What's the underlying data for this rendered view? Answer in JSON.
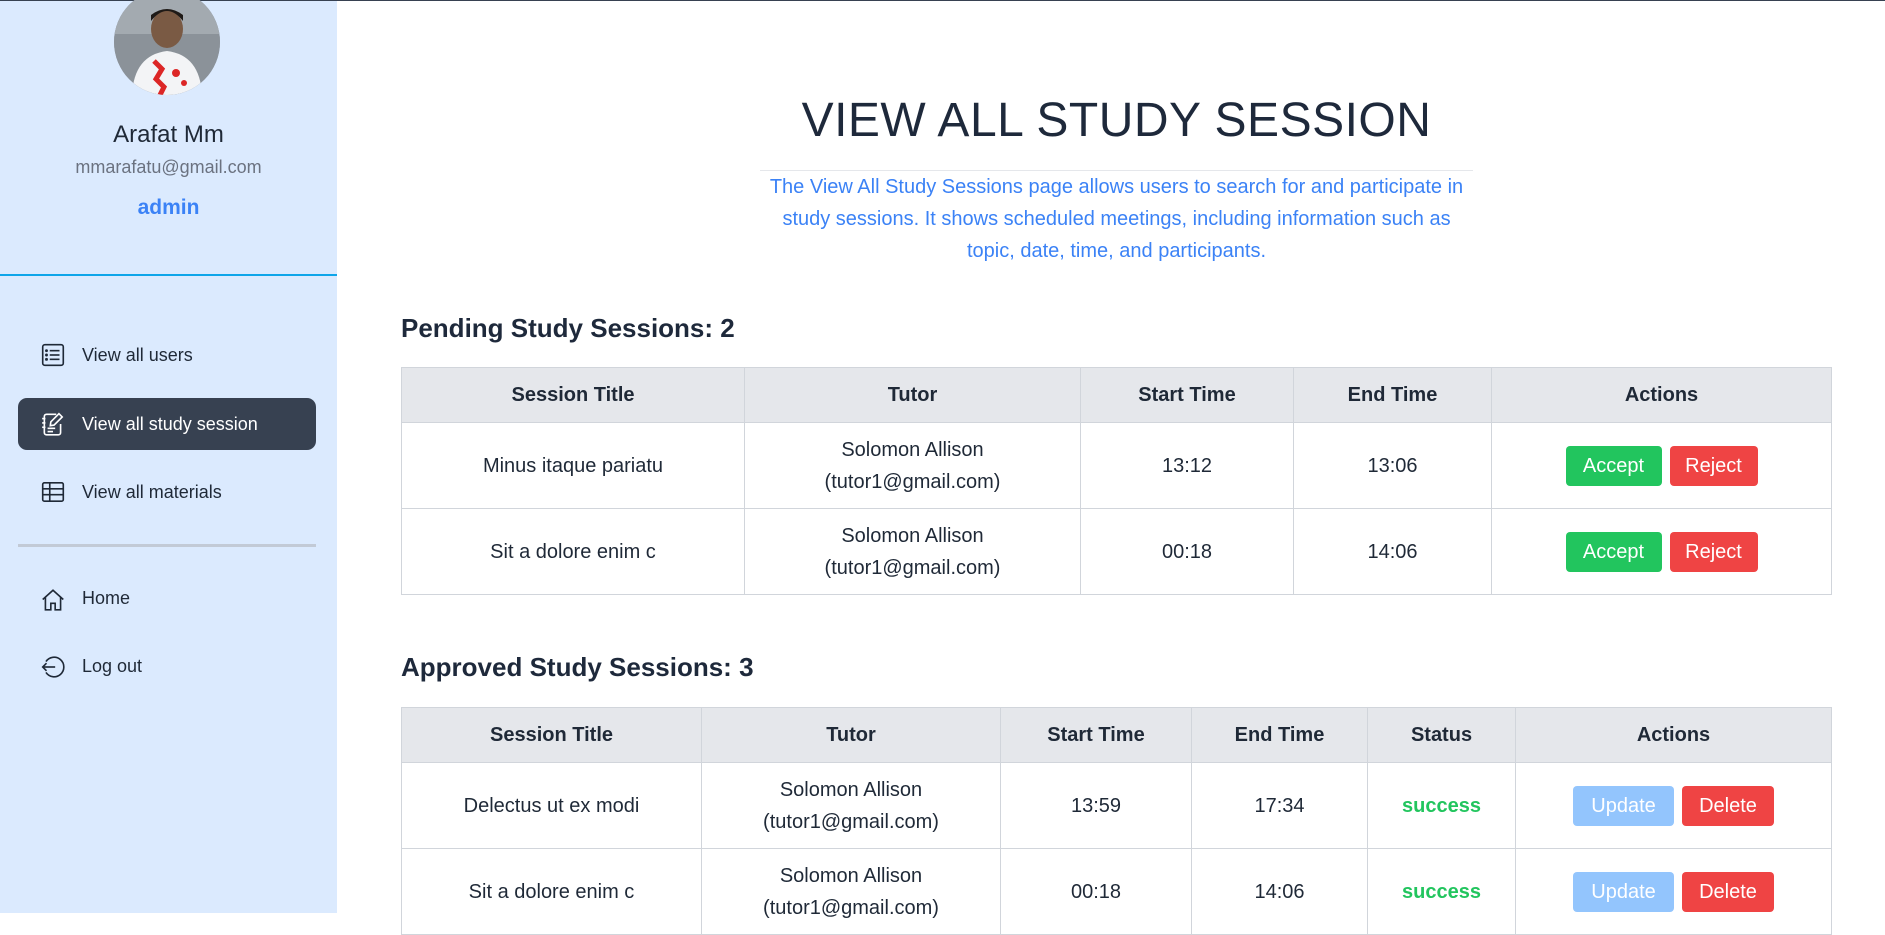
{
  "user": {
    "name": "Arafat Mm",
    "email": "mmarafatu@gmail.com",
    "role": "admin"
  },
  "sidebar": {
    "items": [
      {
        "label": "View all users",
        "icon": "list-icon"
      },
      {
        "label": "View all study session",
        "icon": "edit-note-icon",
        "active": true
      },
      {
        "label": "View all materials",
        "icon": "table-icon"
      },
      {
        "label": "Home",
        "icon": "home-icon"
      },
      {
        "label": "Log out",
        "icon": "logout-icon"
      }
    ]
  },
  "page": {
    "title": "VIEW ALL STUDY SESSION",
    "description": "The View All Study Sessions page allows users to search for and participate in study sessions. It shows scheduled meetings, including information such as topic, date, time, and participants."
  },
  "pending": {
    "heading": "Pending Study Sessions: 2",
    "columns": [
      "Session Title",
      "Tutor",
      "Start Time",
      "End Time",
      "Actions"
    ],
    "rows": [
      {
        "title": "Minus itaque pariatu",
        "tutor_name": "Solomon Allison",
        "tutor_email": "(tutor1@gmail.com)",
        "start": "13:12",
        "end": "13:06"
      },
      {
        "title": "Sit a dolore enim c",
        "tutor_name": "Solomon Allison",
        "tutor_email": "(tutor1@gmail.com)",
        "start": "00:18",
        "end": "14:06"
      }
    ],
    "accept_label": "Accept",
    "reject_label": "Reject"
  },
  "approved": {
    "heading": "Approved Study Sessions: 3",
    "columns": [
      "Session Title",
      "Tutor",
      "Start Time",
      "End Time",
      "Status",
      "Actions"
    ],
    "rows": [
      {
        "title": "Delectus ut ex modi",
        "tutor_name": "Solomon Allison",
        "tutor_email": "(tutor1@gmail.com)",
        "start": "13:59",
        "end": "17:34",
        "status": "success"
      },
      {
        "title": "Sit a dolore enim c",
        "tutor_name": "Solomon Allison",
        "tutor_email": "(tutor1@gmail.com)",
        "start": "00:18",
        "end": "14:06",
        "status": "success"
      }
    ],
    "update_label": "Update",
    "delete_label": "Delete"
  },
  "colors": {
    "sidebar_bg": "#dbeafe",
    "accent": "#3b82f6",
    "active_nav": "#374151",
    "success": "#22c55e",
    "danger": "#ef4444",
    "update": "#93c5fd"
  }
}
